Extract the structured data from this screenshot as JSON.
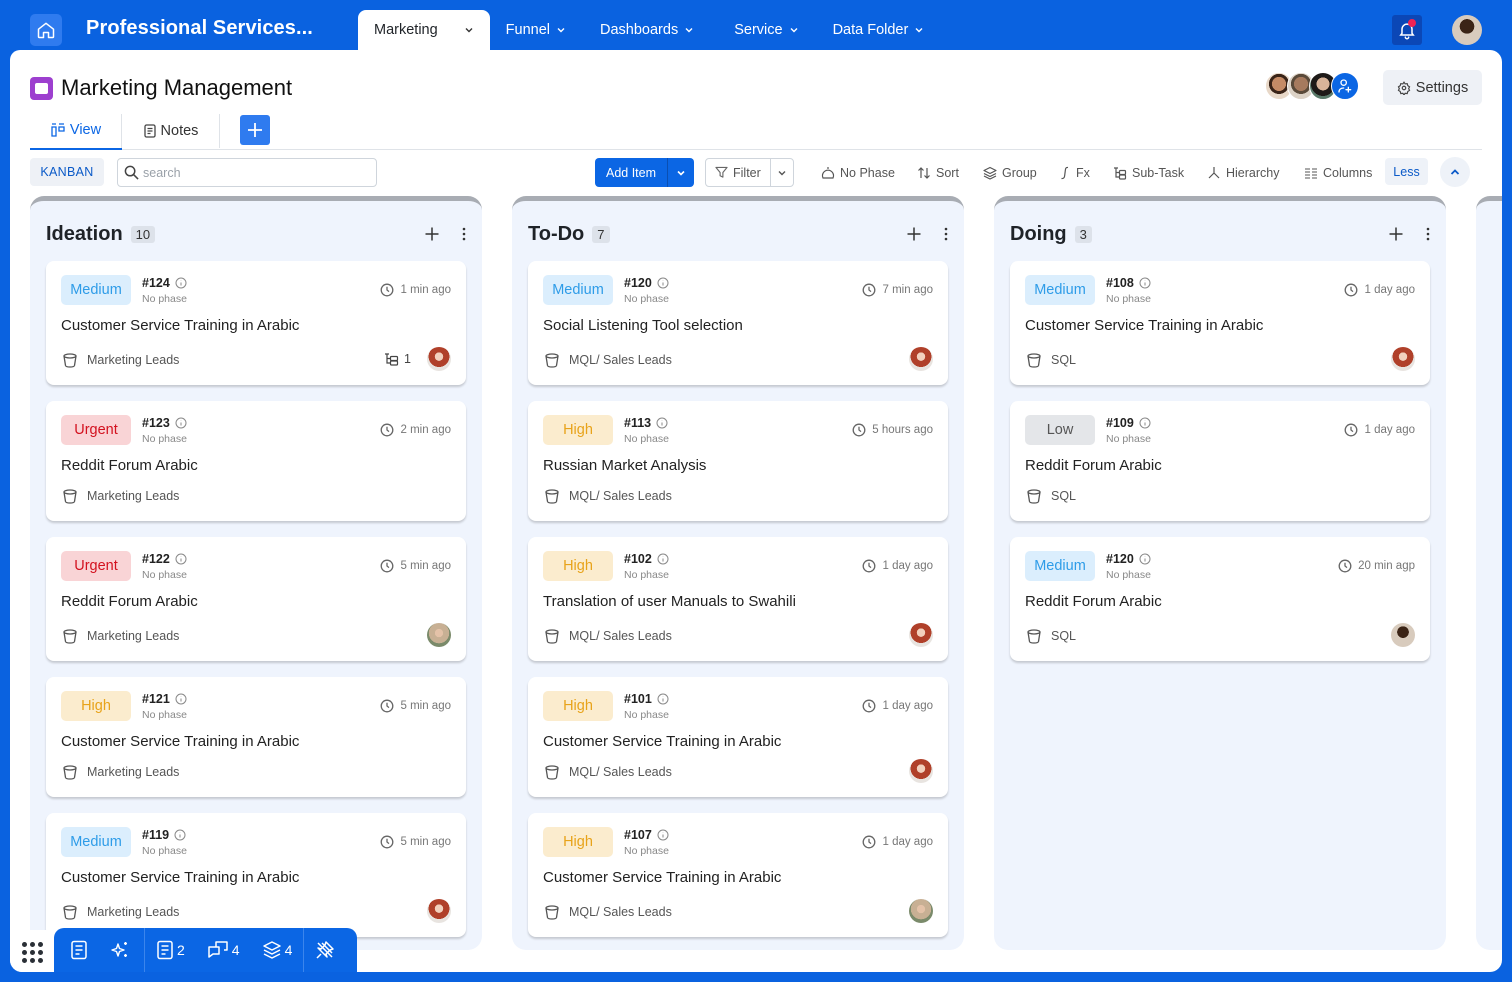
{
  "app": {
    "title": "Professional Services..."
  },
  "nav": {
    "items": [
      {
        "label": "Marketing",
        "active": true
      },
      {
        "label": "Funnel"
      },
      {
        "label": "Dashboards"
      },
      {
        "label": "Service"
      },
      {
        "label": "Data Folder"
      }
    ]
  },
  "header": {
    "notification_indicator": true,
    "page_title": "Marketing Management",
    "settings_label": "Settings",
    "member_count_visible": 3
  },
  "tabs": [
    {
      "label": "View",
      "active": true,
      "icon": "kanban-icon"
    },
    {
      "label": "Notes",
      "icon": "notes-icon"
    }
  ],
  "toolbar": {
    "view_chip": "KANBAN",
    "search_placeholder": "search",
    "search_value": "",
    "add_item_label": "Add Item",
    "filter_label": "Filter",
    "tools": [
      {
        "label": "No Phase",
        "icon": "phase-icon"
      },
      {
        "label": "Sort",
        "icon": "sort-icon"
      },
      {
        "label": "Group",
        "icon": "layers-icon"
      },
      {
        "label": "Fx",
        "icon": "function-icon"
      },
      {
        "label": "Sub-Task",
        "icon": "subtask-icon"
      },
      {
        "label": "Hierarchy",
        "icon": "hierarchy-icon"
      },
      {
        "label": "Columns",
        "icon": "columns-icon"
      }
    ],
    "less_label": "Less"
  },
  "priority_colors": {
    "Medium": {
      "bg": "#dbeefd",
      "fg": "#2e9ce8"
    },
    "Urgent": {
      "bg": "#f9d4d6",
      "fg": "#d3121f"
    },
    "High": {
      "bg": "#fbecce",
      "fg": "#e8a31a"
    },
    "Low": {
      "bg": "#e4e6e9",
      "fg": "#555555"
    }
  },
  "columns": [
    {
      "title": "Ideation",
      "count": "10",
      "cards": [
        {
          "priority": "Medium",
          "id": "#124",
          "phase": "No phase",
          "time": "1 min ago",
          "title": "Customer Service Training in Arabic",
          "bucket": "Marketing Leads",
          "subtasks": "1",
          "assignee": "red"
        },
        {
          "priority": "Urgent",
          "id": "#123",
          "phase": "No phase",
          "time": "2 min ago",
          "title": "Reddit Forum Arabic",
          "bucket": "Marketing Leads",
          "assignee": ""
        },
        {
          "priority": "Urgent",
          "id": "#122",
          "phase": "No phase",
          "time": "5 min ago",
          "title": "Reddit Forum Arabic",
          "bucket": "Marketing Leads",
          "assignee": "hijab"
        },
        {
          "priority": "High",
          "id": "#121",
          "phase": "No phase",
          "time": "5 min ago",
          "title": "Customer Service Training in Arabic",
          "bucket": "Marketing Leads",
          "assignee": ""
        },
        {
          "priority": "Medium",
          "id": "#119",
          "phase": "No phase",
          "time": "5 min ago",
          "title": "Customer Service Training in Arabic",
          "bucket": "Marketing Leads",
          "assignee": "red"
        }
      ]
    },
    {
      "title": "To-Do",
      "count": "7",
      "cards": [
        {
          "priority": "Medium",
          "id": "#120",
          "phase": "No phase",
          "time": "7 min ago",
          "title": "Social Listening Tool selection",
          "bucket": "MQL/ Sales Leads",
          "assignee": "red"
        },
        {
          "priority": "High",
          "id": "#113",
          "phase": "No phase",
          "time": "5 hours ago",
          "title": "Russian Market Analysis",
          "bucket": "MQL/ Sales Leads",
          "assignee": ""
        },
        {
          "priority": "High",
          "id": "#102",
          "phase": "No phase",
          "time": "1 day ago",
          "title": "Translation of user Manuals to Swahili",
          "bucket": "MQL/ Sales Leads",
          "assignee": "red"
        },
        {
          "priority": "High",
          "id": "#101",
          "phase": "No phase",
          "time": "1 day ago",
          "title": "Customer Service Training in Arabic",
          "bucket": "MQL/ Sales Leads",
          "assignee": "red"
        },
        {
          "priority": "High",
          "id": "#107",
          "phase": "No phase",
          "time": "1 day ago",
          "title": "Customer Service Training in Arabic",
          "bucket": "MQL/ Sales Leads",
          "assignee": "hijab"
        }
      ]
    },
    {
      "title": "Doing",
      "count": "3",
      "cards": [
        {
          "priority": "Medium",
          "id": "#108",
          "phase": "No phase",
          "time": "1 day ago",
          "title": "Customer Service Training in Arabic",
          "bucket": "SQL",
          "assignee": "red"
        },
        {
          "priority": "Low",
          "id": "#109",
          "phase": "No phase",
          "time": "1 day ago",
          "title": "Reddit Forum Arabic",
          "bucket": "SQL",
          "assignee": ""
        },
        {
          "priority": "Medium",
          "id": "#120",
          "phase": "No phase",
          "time": "20 min agp",
          "title": "Reddit Forum Arabic",
          "bucket": "SQL",
          "assignee": "man"
        }
      ]
    }
  ],
  "bottom_bar": {
    "items": [
      {
        "icon": "document-icon",
        "count": ""
      },
      {
        "icon": "sparkle-icon",
        "count": ""
      },
      {
        "icon": "notes-icon",
        "count": "2"
      },
      {
        "icon": "comments-icon",
        "count": "4"
      },
      {
        "icon": "layers-icon",
        "count": "4"
      },
      {
        "icon": "unpin-icon",
        "count": ""
      }
    ]
  }
}
